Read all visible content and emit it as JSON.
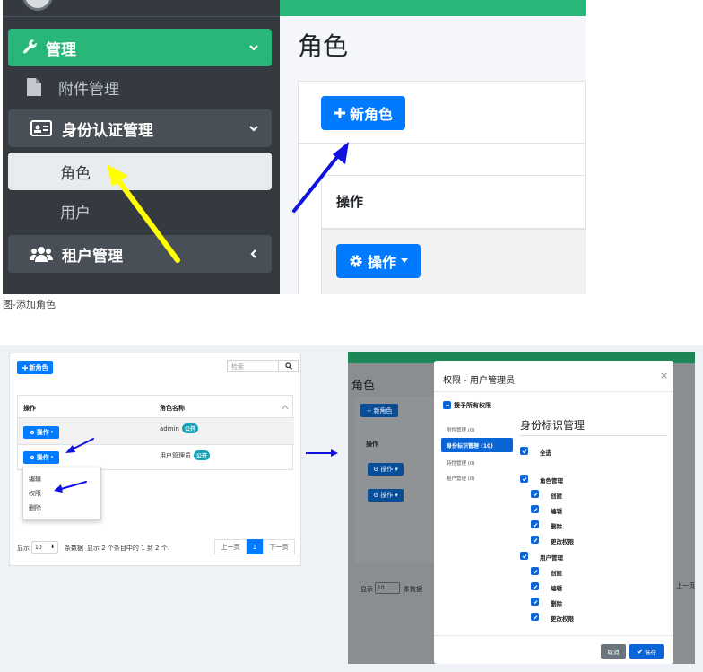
{
  "colors": {
    "brand_green": "#28b779",
    "primary": "#007bff",
    "sidebar_bg": "#343a40",
    "arrow_blue": "#1010e0",
    "arrow_yellow": "#ffff00"
  },
  "top": {
    "sidebar": {
      "mgmt": {
        "label": "管理",
        "icon": "wrench-icon"
      },
      "attach": {
        "label": "附件管理",
        "icon": "file-icon"
      },
      "identity": {
        "label": "身份认证管理",
        "icon": "id-card-icon"
      },
      "role": {
        "label": "角色"
      },
      "user": {
        "label": "用户"
      },
      "tenant": {
        "label": "租户管理",
        "icon": "users-icon"
      }
    },
    "page_title": "角色",
    "new_button": "新角色",
    "table_header": "操作",
    "action_button": "操作"
  },
  "caption": "图-添加角色",
  "bottom_left": {
    "new_button": "新角色",
    "search_placeholder": "检索",
    "col_action": "操作",
    "col_name": "角色名称",
    "rows": [
      {
        "name": "admin",
        "badge": "公开",
        "action": "操作"
      },
      {
        "name": "用户管理员",
        "badge": "公开",
        "action": "操作"
      }
    ],
    "menu": [
      "编辑",
      "权限",
      "删除"
    ],
    "footer_show": "显示",
    "page_len": "10",
    "footer_items": "条数据",
    "info": "显示 2 个条目中的 1 到 2 个.",
    "prev": "上一页",
    "page": "1",
    "next": "下一页"
  },
  "bottom_right": {
    "page_title": "角色",
    "new_button": "新角色",
    "col_action": "操作",
    "action_button": "操作",
    "footer_show": "显示",
    "page_len": "10",
    "footer_items": "条数据",
    "edge_prev": "上一页",
    "modal": {
      "title": "权限 - 用户管理员",
      "grant_all": "授予所有权限",
      "nav": [
        "附件管理 (0)",
        "身份标识管理 (10)",
        "特性管理 (0)",
        "租户管理 (0)"
      ],
      "section_title": "身份标识管理",
      "select_all": "全选",
      "groups": [
        {
          "name": "角色管理",
          "perms": [
            "创建",
            "编辑",
            "删除",
            "更改权限"
          ]
        },
        {
          "name": "用户管理",
          "perms": [
            "创建",
            "编辑",
            "删除",
            "更改权限"
          ]
        }
      ],
      "cancel": "取消",
      "save": "保存"
    }
  }
}
